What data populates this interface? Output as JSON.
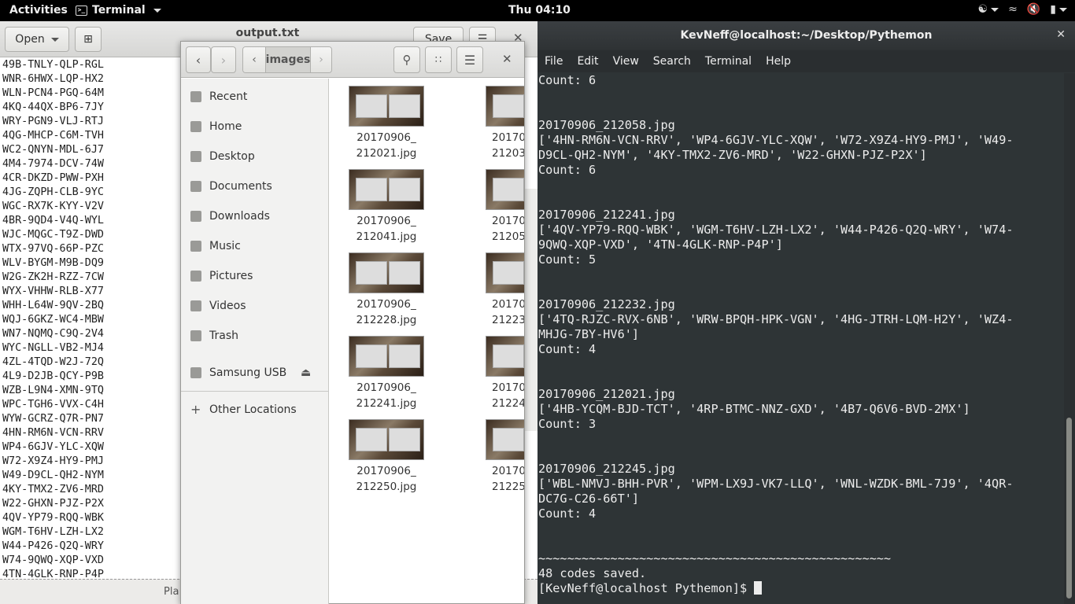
{
  "topbar": {
    "activities": "Activities",
    "app": "Terminal",
    "clock": "Thu 04:10"
  },
  "gedit": {
    "open_label": "Open",
    "title": "output.txt",
    "save_label": "Save",
    "status": "Pla",
    "lines": [
      "49B-TNLY-QLP-RGL",
      "WNR-6HWX-LQP-HX2",
      "WLN-PCN4-PGQ-64M",
      "4KQ-44QX-BP6-7JY",
      "WRY-PGN9-VLJ-RTJ",
      "4QG-MHCP-C6M-TVH",
      "WC2-QNYN-MDL-6J7",
      "4M4-7974-DCV-74W",
      "4CR-DKZD-PWW-PXH",
      "4JG-ZQPH-CLB-9YC",
      "WGC-RX7K-KYY-V2V",
      "4BR-9QD4-V4Q-WYL",
      "WJC-MQGC-T9Z-DWD",
      "WTX-97VQ-66P-PZC",
      "WLV-BYGM-M9B-DQ9",
      "W2G-ZK2H-RZZ-7CW",
      "WYX-VHHW-RLB-X77",
      "WHH-L64W-9QV-2BQ",
      "WQJ-6GKZ-WC4-MBW",
      "WN7-NQMQ-C9Q-2V4",
      "WYC-NGLL-VB2-MJ4",
      "4ZL-4TQD-W2J-72Q",
      "4L9-D2JB-QCY-P9B",
      "WZB-L9N4-XMN-9TQ",
      "WPC-TGH6-VVX-C4H",
      "WYW-GCRZ-Q7R-PN7",
      "4HN-RM6N-VCN-RRV",
      "WP4-6GJV-YLC-XQW",
      "W72-X9Z4-HY9-PMJ",
      "W49-D9CL-QH2-NYM",
      "4KY-TMX2-ZV6-MRD",
      "W22-GHXN-PJZ-P2X",
      "4QV-YP79-RQQ-WBK",
      "WGM-T6HV-LZH-LX2",
      "W44-P426-Q2Q-WRY",
      "W74-9QWQ-XQP-VXD",
      "4TN-4GLK-RNP-P4P"
    ]
  },
  "nautilus": {
    "path_current": "images",
    "sidebar": [
      {
        "label": "Recent",
        "icon": "clock-icon"
      },
      {
        "label": "Home",
        "icon": "home-icon"
      },
      {
        "label": "Desktop",
        "icon": "desktop-icon"
      },
      {
        "label": "Documents",
        "icon": "documents-icon"
      },
      {
        "label": "Downloads",
        "icon": "downloads-icon"
      },
      {
        "label": "Music",
        "icon": "music-icon"
      },
      {
        "label": "Pictures",
        "icon": "pictures-icon"
      },
      {
        "label": "Videos",
        "icon": "videos-icon"
      },
      {
        "label": "Trash",
        "icon": "trash-icon"
      },
      {
        "label": "Samsung USB",
        "icon": "drive-icon"
      },
      {
        "label": "Other Locations",
        "icon": "plus-icon"
      }
    ],
    "files": [
      {
        "l1": "20170906_",
        "l2": "212021.jpg"
      },
      {
        "l1": "20170",
        "l2": "21203"
      },
      {
        "l1": "20170906_",
        "l2": "212041.jpg"
      },
      {
        "l1": "20170",
        "l2": "21205"
      },
      {
        "l1": "20170906_",
        "l2": "212228.jpg"
      },
      {
        "l1": "20170",
        "l2": "21223"
      },
      {
        "l1": "20170906_",
        "l2": "212241.jpg"
      },
      {
        "l1": "20170",
        "l2": "21224"
      },
      {
        "l1": "20170906_",
        "l2": "212250.jpg"
      },
      {
        "l1": "20170",
        "l2": "21225"
      }
    ]
  },
  "terminal": {
    "title": "KevNeff@localhost:~/Desktop/Pythemon",
    "menu": [
      "File",
      "Edit",
      "View",
      "Search",
      "Terminal",
      "Help"
    ],
    "lines": [
      "Count: 6",
      "",
      "",
      "20170906_212058.jpg",
      "['4HN-RM6N-VCN-RRV', 'WP4-6GJV-YLC-XQW', 'W72-X9Z4-HY9-PMJ', 'W49-",
      "D9CL-QH2-NYM', '4KY-TMX2-ZV6-MRD', 'W22-GHXN-PJZ-P2X']",
      "Count: 6",
      "",
      "",
      "20170906_212241.jpg",
      "['4QV-YP79-RQQ-WBK', 'WGM-T6HV-LZH-LX2', 'W44-P426-Q2Q-WRY', 'W74-",
      "9QWQ-XQP-VXD', '4TN-4GLK-RNP-P4P']",
      "Count: 5",
      "",
      "",
      "20170906_212232.jpg",
      "['4TQ-RJZC-RVX-6NB', 'WRW-BPQH-HPK-VGN', '4HG-JTRH-LQM-H2Y', 'WZ4-",
      "MHJG-7BY-HV6']",
      "Count: 4",
      "",
      "",
      "20170906_212021.jpg",
      "['4HB-YCQM-BJD-TCT', '4RP-BTMC-NNZ-GXD', '4B7-Q6V6-BVD-2MX']",
      "Count: 3",
      "",
      "",
      "20170906_212245.jpg",
      "['WBL-NMVJ-BHH-PVR', 'WPM-LX9J-VK7-LLQ', 'WNL-WZDK-BML-7J9', '4QR-",
      "DC7G-C26-66T']",
      "Count: 4",
      "",
      "",
      "~~~~~~~~~~~~~~~~~~~~~~~~~~~~~~~~~~~~~~~~~~~~~~~~~",
      "48 codes saved."
    ],
    "prompt": "[KevNeff@localhost Pythemon]$ "
  }
}
